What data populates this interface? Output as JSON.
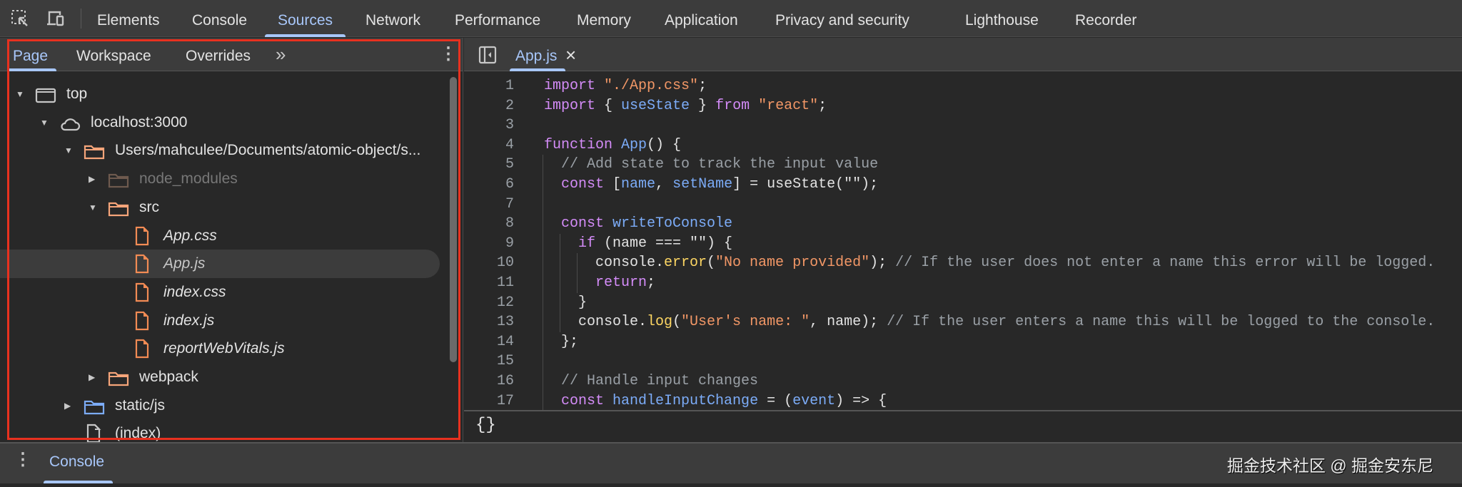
{
  "toolbar": {
    "icons": [
      "inspect-element-icon",
      "device-toolbar-icon"
    ],
    "tabs": [
      "Elements",
      "Console",
      "Sources",
      "Network",
      "Performance",
      "Memory",
      "Application",
      "Privacy and security",
      "Lighthouse",
      "Recorder"
    ],
    "active_tab": "Sources"
  },
  "navigator": {
    "tabs": [
      "Page",
      "Workspace",
      "Overrides"
    ],
    "more_label": "»",
    "menu_label": "⋮",
    "tree": [
      {
        "label": "top",
        "icon": "frame",
        "expanded": true,
        "depth": 0
      },
      {
        "label": "localhost:3000",
        "icon": "cloud",
        "expanded": true,
        "depth": 1
      },
      {
        "label": "Users/mahculee/Documents/atomic-object/s...",
        "icon": "folder",
        "expanded": true,
        "depth": 2
      },
      {
        "label": "node_modules",
        "icon": "folder-dim",
        "expanded": false,
        "depth": 3
      },
      {
        "label": "src",
        "icon": "folder",
        "expanded": true,
        "depth": 3
      },
      {
        "label": "App.css",
        "icon": "file",
        "depth": 4
      },
      {
        "label": "App.js",
        "icon": "file",
        "depth": 4,
        "selected": true
      },
      {
        "label": "index.css",
        "icon": "file",
        "depth": 4
      },
      {
        "label": "index.js",
        "icon": "file",
        "depth": 4
      },
      {
        "label": "reportWebVitals.js",
        "icon": "file",
        "depth": 4
      },
      {
        "label": "webpack",
        "icon": "folder",
        "expanded": false,
        "depth": 3
      },
      {
        "label": "static/js",
        "icon": "folder-blue",
        "expanded": false,
        "depth": 2
      },
      {
        "label": "(index)",
        "icon": "file-white",
        "depth": 2
      }
    ]
  },
  "editor": {
    "file_tab": "App.js",
    "close_label": "×",
    "format_label": "{}",
    "lines": [
      {
        "n": "1",
        "indent": 0,
        "tokens": [
          [
            "kw",
            "import"
          ],
          [
            "",
            " "
          ],
          [
            "str",
            "\"./App.css\""
          ],
          [
            "",
            ";"
          ]
        ]
      },
      {
        "n": "2",
        "indent": 0,
        "tokens": [
          [
            "kw",
            "import"
          ],
          [
            "",
            " { "
          ],
          [
            "id",
            "useState"
          ],
          [
            "",
            " } "
          ],
          [
            "kw",
            "from"
          ],
          [
            "",
            " "
          ],
          [
            "str",
            "\"react\""
          ],
          [
            "",
            ";"
          ]
        ]
      },
      {
        "n": "3",
        "indent": 0,
        "tokens": []
      },
      {
        "n": "4",
        "indent": 0,
        "tokens": [
          [
            "kw",
            "function"
          ],
          [
            "",
            " "
          ],
          [
            "id",
            "App"
          ],
          [
            "",
            "() {"
          ]
        ]
      },
      {
        "n": "5",
        "indent": 1,
        "tokens": [
          [
            "cm",
            "// Add state to track the input value"
          ]
        ]
      },
      {
        "n": "6",
        "indent": 1,
        "tokens": [
          [
            "kw",
            "const"
          ],
          [
            "",
            " ["
          ],
          [
            "id",
            "name"
          ],
          [
            "",
            ", "
          ],
          [
            "id",
            "setName"
          ],
          [
            "",
            "] = useState(\"\");"
          ]
        ]
      },
      {
        "n": "7",
        "indent": 1,
        "tokens": []
      },
      {
        "n": "8",
        "indent": 1,
        "tokens": [
          [
            "kw",
            "const"
          ],
          [
            "",
            " "
          ],
          [
            "id",
            "writeToConsole"
          ],
          [
            "",
            "",
            " = () => {"
          ],
          [
            "",
            ""
          ]
        ]
      },
      {
        "n": "9",
        "indent": 2,
        "tokens": [
          [
            "kw",
            "if"
          ],
          [
            "",
            " (name === \"\") {"
          ]
        ]
      },
      {
        "n": "10",
        "indent": 3,
        "tokens": [
          [
            "",
            "console."
          ],
          [
            "fn",
            "error"
          ],
          [
            "",
            "("
          ],
          [
            "str",
            "\"No name provided\""
          ],
          [
            "",
            "); "
          ],
          [
            "cm",
            "// If the user does not enter a name this error will be logged."
          ]
        ]
      },
      {
        "n": "11",
        "indent": 3,
        "tokens": [
          [
            "kw",
            "return"
          ],
          [
            "",
            ";"
          ]
        ]
      },
      {
        "n": "12",
        "indent": 2,
        "tokens": [
          [
            "",
            "}"
          ]
        ]
      },
      {
        "n": "13",
        "indent": 2,
        "tokens": [
          [
            "",
            "console."
          ],
          [
            "fn",
            "log"
          ],
          [
            "",
            "("
          ],
          [
            "str",
            "\"User's name: \""
          ],
          [
            "",
            ", name); "
          ],
          [
            "cm",
            "// If the user enters a name this will be logged to the console."
          ]
        ]
      },
      {
        "n": "14",
        "indent": 1,
        "tokens": [
          [
            "",
            "};"
          ]
        ]
      },
      {
        "n": "15",
        "indent": 1,
        "tokens": []
      },
      {
        "n": "16",
        "indent": 1,
        "tokens": [
          [
            "cm",
            "// Handle input changes"
          ]
        ]
      },
      {
        "n": "17",
        "indent": 1,
        "tokens": [
          [
            "kw",
            "const"
          ],
          [
            "",
            " "
          ],
          [
            "id",
            "handleInputChange"
          ],
          [
            "",
            " = ("
          ],
          [
            "id",
            "event"
          ],
          [
            "",
            ") => {"
          ]
        ]
      }
    ]
  },
  "drawer": {
    "menu_label": "⋮",
    "tab": "Console",
    "watermark": "掘金技术社区 @ 掘金安东尼"
  },
  "colors": {
    "accent": "#a8c7fa",
    "highlight_box": "#e8311f",
    "file_icon": "#f28b54",
    "folder_blue": "#7cacf8"
  }
}
